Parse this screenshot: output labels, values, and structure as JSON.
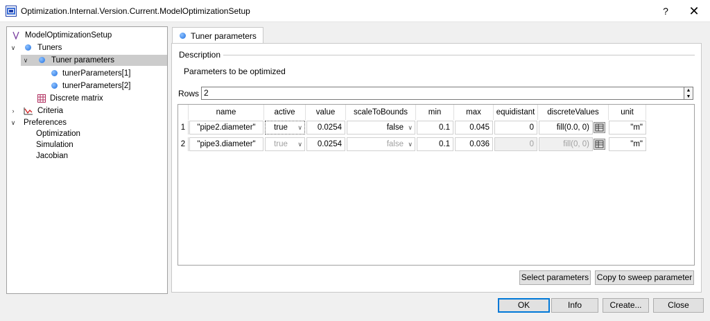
{
  "window": {
    "title": "Optimization.Internal.Version.Current.ModelOptimizationSetup",
    "help_label": "?",
    "close_label": "✕"
  },
  "tree": {
    "items": [
      {
        "label": "ModelOptimizationSetup",
        "icon": "model-v-icon"
      },
      {
        "label": "Tuners",
        "icon": "blue-dot-icon"
      },
      {
        "label": "Tuner parameters",
        "icon": "blue-dot-icon"
      },
      {
        "label": "tunerParameters[1]",
        "icon": "blue-dot-icon"
      },
      {
        "label": "tunerParameters[2]",
        "icon": "blue-dot-icon"
      },
      {
        "label": "Discrete matrix",
        "icon": "matrix-icon"
      },
      {
        "label": "Criteria",
        "icon": "criteria-icon"
      },
      {
        "label": "Preferences"
      },
      {
        "label": "Optimization"
      },
      {
        "label": "Simulation"
      },
      {
        "label": "Jacobian"
      }
    ]
  },
  "tab": {
    "label": "Tuner parameters"
  },
  "description": {
    "section_label": "Description",
    "text": "Parameters to be optimized"
  },
  "rows": {
    "label": "Rows",
    "value": "2"
  },
  "table": {
    "columns": [
      "name",
      "active",
      "value",
      "scaleToBounds",
      "min",
      "max",
      "equidistant",
      "discreteValues",
      "unit"
    ],
    "rows": [
      {
        "index": "1",
        "name": "\"pipe2.diameter\"",
        "active": "true",
        "value": "0.0254",
        "scaleToBounds": "false",
        "min": "0.1",
        "max": "0.045",
        "equidistant": "0",
        "discreteValues": "fill(0.0, 0)",
        "unit": "\"m\""
      },
      {
        "index": "2",
        "name": "\"pipe3.diameter\"",
        "active": "true",
        "value": "0.0254",
        "scaleToBounds": "false",
        "min": "0.1",
        "max": "0.036",
        "equidistant": "0",
        "discreteValues": "fill(0, 0)",
        "unit": "\"m\""
      }
    ]
  },
  "buttons": {
    "select_parameters": "Select parameters",
    "copy_sweep": "Copy to sweep parameter",
    "ok": "OK",
    "info": "Info",
    "create": "Create...",
    "close": "Close"
  }
}
